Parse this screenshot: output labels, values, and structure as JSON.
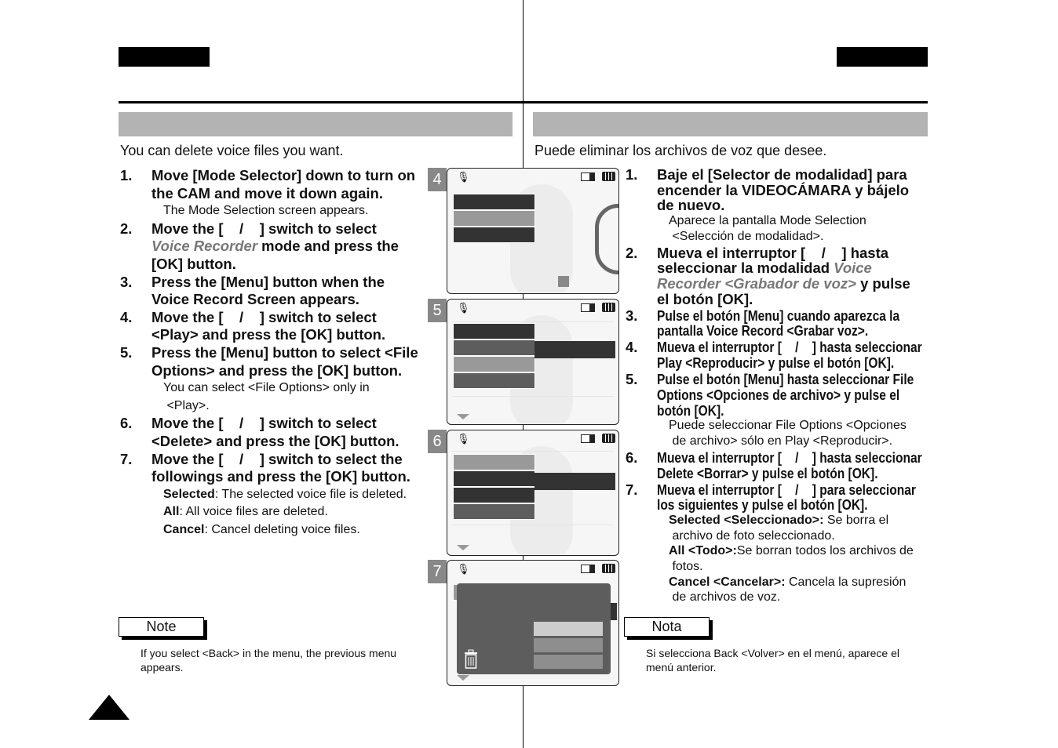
{
  "colors": {
    "band": "#b3b3b3",
    "accent_italic": "#777777",
    "screen_dark": "#333333",
    "screen_mid": "#5d5d5d",
    "screen_light": "#999999"
  },
  "left": {
    "intro": "You can delete voice files you want.",
    "steps": [
      {
        "num": "1.",
        "lines": [
          [
            [
              "b",
              "Move [Mode Selector] down to turn on"
            ]
          ],
          [
            [
              "b",
              "the CAM and move it down again."
            ]
          ]
        ],
        "sub": [
          [
            [
              "r",
              "The Mode Selection screen appears."
            ]
          ]
        ]
      },
      {
        "num": "2.",
        "lines": [
          [
            [
              "b",
              "Move the [    /    ] switch to select"
            ]
          ],
          [
            [
              "i",
              "Voice Recorder"
            ],
            [
              "b",
              " mode and press the"
            ]
          ],
          [
            [
              "b",
              "[OK] button."
            ]
          ]
        ]
      },
      {
        "num": "3.",
        "lines": [
          [
            [
              "b",
              "Press the [Menu] button when the"
            ]
          ],
          [
            [
              "b",
              "Voice Record Screen appears."
            ]
          ]
        ]
      },
      {
        "num": "4.",
        "lines": [
          [
            [
              "b",
              "Move the [    /    ] switch to select"
            ]
          ],
          [
            [
              "b",
              "<Play> and press the [OK] button."
            ]
          ]
        ]
      },
      {
        "num": "5.",
        "lines": [
          [
            [
              "b",
              "Press the [Menu] button to select <File"
            ]
          ],
          [
            [
              "b",
              "Options> and press the [OK] button."
            ]
          ]
        ],
        "sub": [
          [
            [
              "r",
              "You can select <File Options> only in"
            ]
          ],
          [
            [
              "r",
              " <Play>."
            ]
          ]
        ]
      },
      {
        "num": "6.",
        "lines": [
          [
            [
              "b",
              "Move the [    /    ] switch to select"
            ]
          ],
          [
            [
              "b",
              "<Delete> and press the [OK] button."
            ]
          ]
        ]
      },
      {
        "num": "7.",
        "lines": [
          [
            [
              "b",
              "Move the [    /    ] switch to select the"
            ]
          ],
          [
            [
              "b",
              "followings and press the [OK] button."
            ]
          ]
        ],
        "sub": [
          [
            [
              "b",
              "Selected"
            ],
            [
              "r",
              ": The selected voice file is deleted."
            ]
          ],
          [
            [
              "b",
              "All"
            ],
            [
              "r",
              ": All voice files are deleted."
            ]
          ],
          [
            [
              "b",
              "Cancel"
            ],
            [
              "r",
              ": Cancel deleting voice files."
            ]
          ]
        ]
      }
    ],
    "note_label": "Note",
    "note_lines": [
      "If you select <Back> in the menu, the previous menu",
      "appears."
    ]
  },
  "right": {
    "intro": "Puede eliminar los archivos de voz que desee.",
    "steps": [
      {
        "num": "1.",
        "lines": [
          [
            [
              "b",
              "Baje el [Selector de modalidad] para"
            ]
          ],
          [
            [
              "b",
              "encender la VIDEOCÁMARA y bájelo"
            ]
          ],
          [
            [
              "b",
              "de nuevo."
            ]
          ]
        ],
        "sub": [
          [
            [
              "r",
              "Aparece la pantalla Mode Selection"
            ]
          ],
          [
            [
              "r",
              " <Selección de modalidad>."
            ]
          ]
        ]
      },
      {
        "num": "2.",
        "lines": [
          [
            [
              "b",
              "Mueva el interruptor [    /    ] hasta"
            ]
          ],
          [
            [
              "b",
              "seleccionar la modalidad "
            ],
            [
              "i",
              "Voice"
            ]
          ],
          [
            [
              "i",
              "Recorder <Grabador de voz>"
            ],
            [
              "b",
              " y pulse"
            ]
          ],
          [
            [
              "b",
              "el botón [OK]."
            ]
          ]
        ]
      },
      {
        "num": "3.",
        "cond": true,
        "lines": [
          [
            [
              "b",
              "Pulse el botón [Menu] cuando aparezca la"
            ]
          ],
          [
            [
              "b",
              "pantalla Voice Record <Grabar voz>."
            ]
          ]
        ]
      },
      {
        "num": "4.",
        "cond": true,
        "lines": [
          [
            [
              "b",
              "Mueva el interruptor [    /    ] hasta seleccionar"
            ]
          ],
          [
            [
              "b",
              "Play <Reproducir> y pulse el botón [OK]."
            ]
          ]
        ]
      },
      {
        "num": "5.",
        "cond": true,
        "lines": [
          [
            [
              "b",
              "Pulse el botón [Menu] hasta seleccionar File"
            ]
          ],
          [
            [
              "b",
              "Options <Opciones de archivo> y pulse el"
            ]
          ],
          [
            [
              "b",
              "botón [OK]."
            ]
          ]
        ],
        "sub": [
          [
            [
              "r",
              "Puede seleccionar File Options <Opciones"
            ]
          ],
          [
            [
              "r",
              " de archivo> sólo en Play <Reproducir>."
            ]
          ]
        ]
      },
      {
        "num": "6.",
        "cond": true,
        "lines": [
          [
            [
              "b",
              "Mueva el interruptor [    /    ] hasta seleccionar"
            ]
          ],
          [
            [
              "b",
              "Delete <Borrar> y pulse el botón [OK]."
            ]
          ]
        ]
      },
      {
        "num": "7.",
        "cond": true,
        "lines": [
          [
            [
              "b",
              "Mueva el interruptor [    /    ] para seleccionar"
            ]
          ],
          [
            [
              "b",
              "los siguientes y pulse el botón [OK]."
            ]
          ]
        ],
        "sub": [
          [
            [
              "b",
              "Selected <Seleccionado>:"
            ],
            [
              "r",
              " Se borra el"
            ]
          ],
          [
            [
              "r",
              " archivo de foto seleccionado."
            ]
          ],
          [
            [
              "b",
              "All <Todo>:"
            ],
            [
              "r",
              "Se borran todos los archivos de"
            ]
          ],
          [
            [
              "r",
              " fotos."
            ]
          ],
          [
            [
              "b",
              "Cancel <Cancelar>:"
            ],
            [
              "r",
              " Cancela la supresión"
            ]
          ],
          [
            [
              "r",
              " de archivos de voz."
            ]
          ]
        ]
      }
    ],
    "note_label": "Nota",
    "note_lines": [
      "Si selecciona Back <Volver> en el menú, aparece el",
      "menú anterior."
    ]
  },
  "screens": [
    {
      "step": "4",
      "icons": [
        "microphone-icon",
        "memory-icon",
        "battery-icon"
      ]
    },
    {
      "step": "5",
      "icons": [
        "microphone-icon",
        "memory-icon",
        "battery-icon",
        "scroll-down-arrow-icon"
      ]
    },
    {
      "step": "6",
      "icons": [
        "microphone-icon",
        "memory-icon",
        "battery-icon",
        "scroll-down-arrow-icon"
      ]
    },
    {
      "step": "7",
      "icons": [
        "microphone-icon",
        "memory-icon",
        "battery-icon",
        "trash-icon",
        "scroll-down-arrow-icon"
      ]
    }
  ]
}
